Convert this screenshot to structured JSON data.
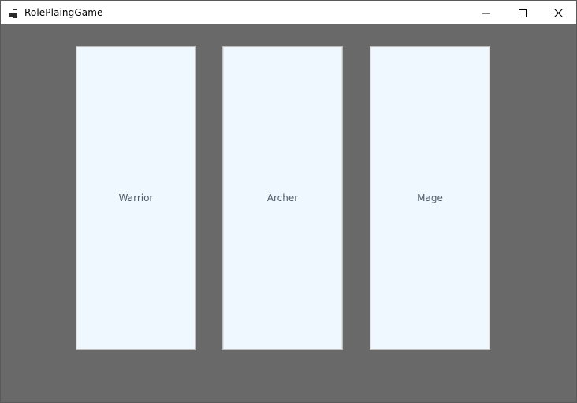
{
  "window": {
    "title": "RolePlaingGame",
    "icon": "app-window-icon",
    "controls": {
      "minimize_icon": "minimize-icon",
      "maximize_icon": "maximize-icon",
      "close_icon": "close-icon"
    }
  },
  "characters": [
    {
      "label": "Warrior"
    },
    {
      "label": "Archer"
    },
    {
      "label": "Mage"
    }
  ],
  "colors": {
    "client_background": "#696969",
    "card_background": "#eff7ff",
    "card_label": "#4f5d66"
  }
}
